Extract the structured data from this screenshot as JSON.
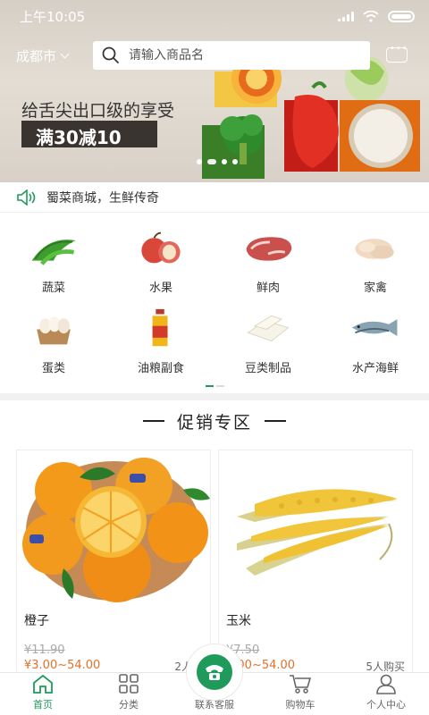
{
  "status": {
    "time": "上午10:05"
  },
  "header": {
    "city": "成都市",
    "search_placeholder": "请输入商品名"
  },
  "banner": {
    "slogan": "给舌尖出口级的享受",
    "promo": "满30减10",
    "slides": 4,
    "active_slide": 1
  },
  "notice": {
    "text": "蜀菜商城，生鲜传奇"
  },
  "categories": [
    {
      "label": "蔬菜",
      "icon": "vegetable-icon"
    },
    {
      "label": "水果",
      "icon": "apple-icon"
    },
    {
      "label": "鲜肉",
      "icon": "meat-icon"
    },
    {
      "label": "家禽",
      "icon": "poultry-icon"
    },
    {
      "label": "蛋类",
      "icon": "egg-icon"
    },
    {
      "label": "油粮副食",
      "icon": "oil-icon"
    },
    {
      "label": "豆类制品",
      "icon": "tofu-icon"
    },
    {
      "label": "水产海鲜",
      "icon": "fish-icon"
    }
  ],
  "section": {
    "title": "促销专区"
  },
  "products": [
    {
      "name": "橙子",
      "old_price": "¥11.90",
      "price": "¥3.00~54.00",
      "sold": "2人购"
    },
    {
      "name": "玉米",
      "old_price": "¥7.50",
      "price": "3.00~54.00",
      "sold": "5人购买"
    }
  ],
  "tabbar": {
    "home": "首页",
    "category": "分类",
    "service": "联系客服",
    "cart": "购物车",
    "profile": "个人中心"
  },
  "colors": {
    "accent": "#1f9a5b",
    "price": "#e0712c",
    "banner_dark": "#3a3430"
  }
}
